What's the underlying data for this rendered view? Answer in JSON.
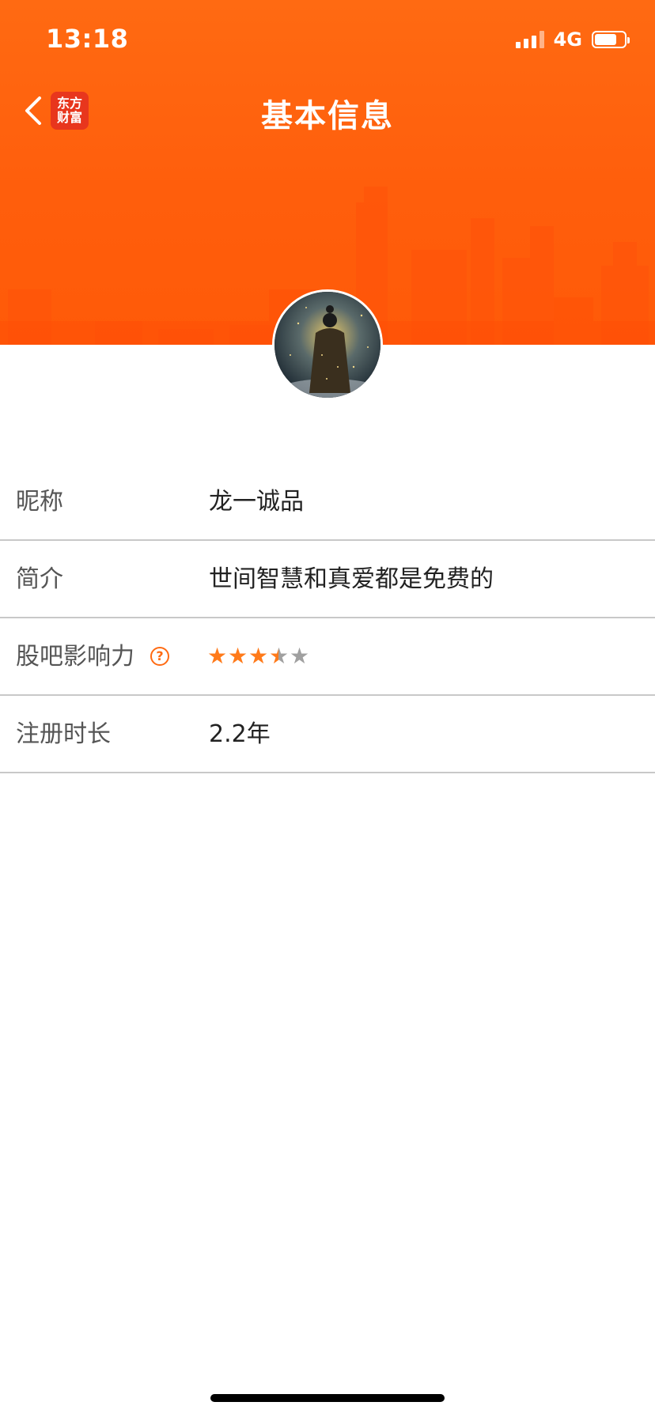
{
  "status_bar": {
    "time": "13:18",
    "network": "4G",
    "signal_bars": 4,
    "battery_level": 0.75
  },
  "nav": {
    "title": "基本信息",
    "brand_logo": {
      "line1": "东方",
      "line2": "财富"
    }
  },
  "colors": {
    "header_orange": "#ff6a12",
    "accent_orange": "#ff7a1a",
    "brand_red": "#e8361d",
    "star_inactive": "#a0a0a0"
  },
  "profile": {
    "rows": [
      {
        "label": "昵称",
        "value": "龙一诚品"
      },
      {
        "label": "简介",
        "value": "世间智慧和真爱都是免费的"
      },
      {
        "label": "股吧影响力",
        "help_icon": "?",
        "rating": 3.5,
        "rating_max": 5
      },
      {
        "label": "注册时长",
        "value": "2.2年"
      }
    ]
  }
}
